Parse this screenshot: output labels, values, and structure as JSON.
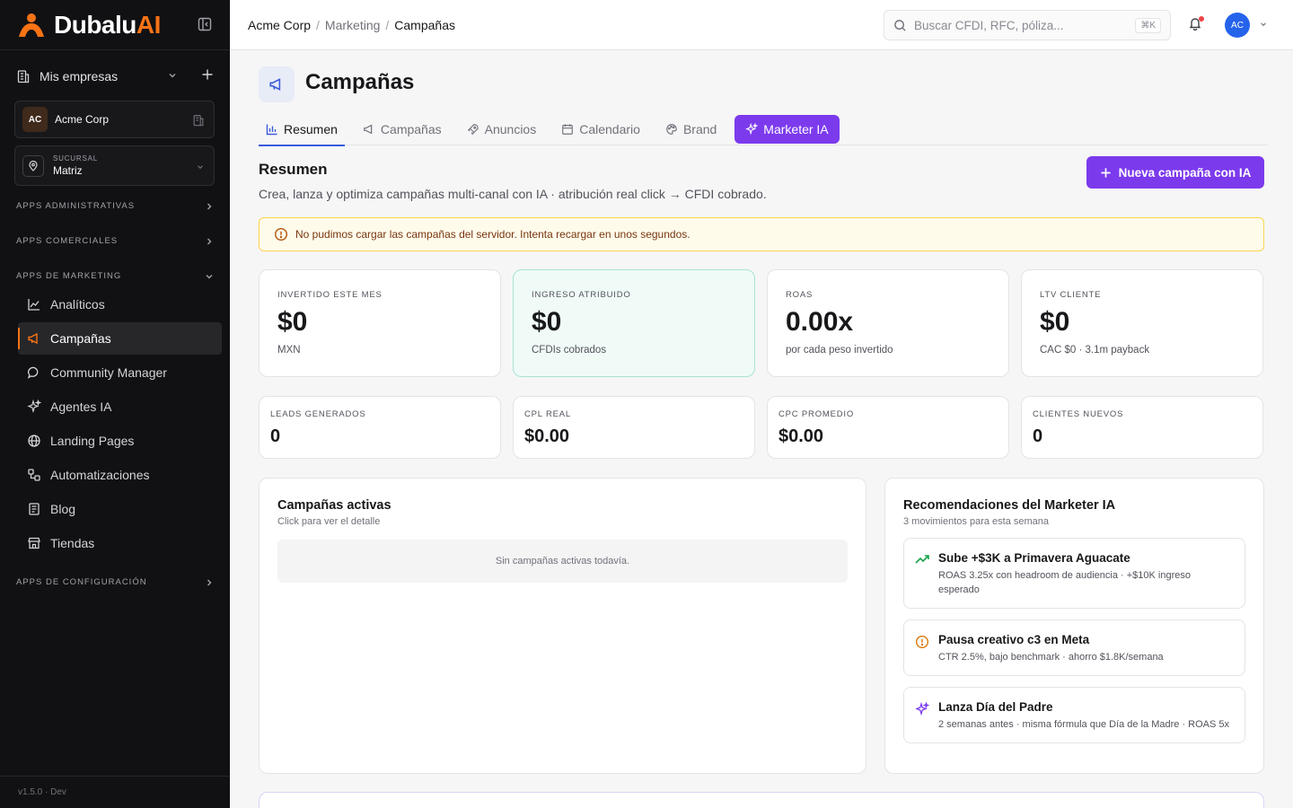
{
  "brand": {
    "name_a": "Dubalu",
    "name_b": "AI"
  },
  "sidebar": {
    "mis_empresas": "Mis empresas",
    "company": {
      "initials": "AC",
      "name": "Acme Corp"
    },
    "branch": {
      "label": "SUCURSAL",
      "value": "Matriz"
    },
    "sections": {
      "admin": "APPS ADMINISTRATIVAS",
      "comercial": "APPS COMERCIALES",
      "marketing": "APPS DE MARKETING",
      "config": "APPS DE CONFIGURACIÓN"
    },
    "items": [
      {
        "label": "Analíticos",
        "icon": "chart-line-icon"
      },
      {
        "label": "Campañas",
        "icon": "megaphone-icon",
        "active": true
      },
      {
        "label": "Community Manager",
        "icon": "chat-bubble-icon"
      },
      {
        "label": "Agentes IA",
        "icon": "sparkles-icon"
      },
      {
        "label": "Landing Pages",
        "icon": "globe-icon"
      },
      {
        "label": "Automatizaciones",
        "icon": "workflow-icon"
      },
      {
        "label": "Blog",
        "icon": "newspaper-icon"
      },
      {
        "label": "Tiendas",
        "icon": "store-icon"
      }
    ],
    "version": "v1.5.0 · Dev"
  },
  "topbar": {
    "breadcrumb": [
      "Acme Corp",
      "Marketing",
      "Campañas"
    ],
    "search_placeholder": "Buscar CFDI, RFC, póliza...",
    "search_kbd": "⌘K",
    "avatar": "AC"
  },
  "page": {
    "title": "Campañas",
    "tabs": [
      {
        "label": "Resumen",
        "icon": "bar-chart-icon"
      },
      {
        "label": "Campañas",
        "icon": "megaphone-icon"
      },
      {
        "label": "Anuncios",
        "icon": "rocket-icon"
      },
      {
        "label": "Calendario",
        "icon": "calendar-icon"
      },
      {
        "label": "Brand",
        "icon": "palette-icon"
      },
      {
        "label": "Marketer IA",
        "icon": "sparkles-icon"
      }
    ],
    "section_title": "Resumen",
    "section_subtitle": "Crea, lanza y optimiza campañas multi-canal con IA · atribución real click → CFDI cobrado.",
    "new_button": "Nueva campaña con IA",
    "alert": "No pudimos cargar las campañas del servidor. Intenta recargar en unos segundos."
  },
  "kpis_big": [
    {
      "label": "INVERTIDO ESTE MES",
      "value": "$0",
      "sub": "MXN"
    },
    {
      "label": "INGRESO ATRIBUIDO",
      "value": "$0",
      "sub": "CFDIs cobrados"
    },
    {
      "label": "ROAS",
      "value": "0.00x",
      "sub": "por cada peso invertido"
    },
    {
      "label": "LTV CLIENTE",
      "value": "$0",
      "sub": "CAC $0 · 3.1m payback"
    }
  ],
  "kpis_small": [
    {
      "label": "LEADS GENERADOS",
      "value": "0"
    },
    {
      "label": "CPL REAL",
      "value": "$0.00"
    },
    {
      "label": "CPC PROMEDIO",
      "value": "$0.00"
    },
    {
      "label": "CLIENTES NUEVOS",
      "value": "0"
    }
  ],
  "active_campaigns": {
    "title": "Campañas activas",
    "subtitle": "Click para ver el detalle",
    "empty": "Sin campañas activas todavía."
  },
  "recommendations": {
    "title": "Recomendaciones del Marketer IA",
    "subtitle": "3 movimientos para esta semana",
    "items": [
      {
        "title": "Sube +$3K a Primavera Aguacate",
        "desc": "ROAS 3.25x con headroom de audiencia · +$10K ingreso esperado",
        "icon": "trending-up-icon",
        "color": "#16a34a"
      },
      {
        "title": "Pausa creativo c3 en Meta",
        "desc": "CTR 2.5%, bajo benchmark · ahorro $1.8K/semana",
        "icon": "alert-circle-icon",
        "color": "#d97706"
      },
      {
        "title": "Lanza Día del Padre",
        "desc": "2 semanas antes · misma fórmula que Día de la Madre · ROAS 5x",
        "icon": "sparkles-icon",
        "color": "#7c3aed"
      }
    ]
  },
  "colors": {
    "accent": "#7c3aed",
    "brand": "#f97316",
    "sidebar": "#111113"
  }
}
